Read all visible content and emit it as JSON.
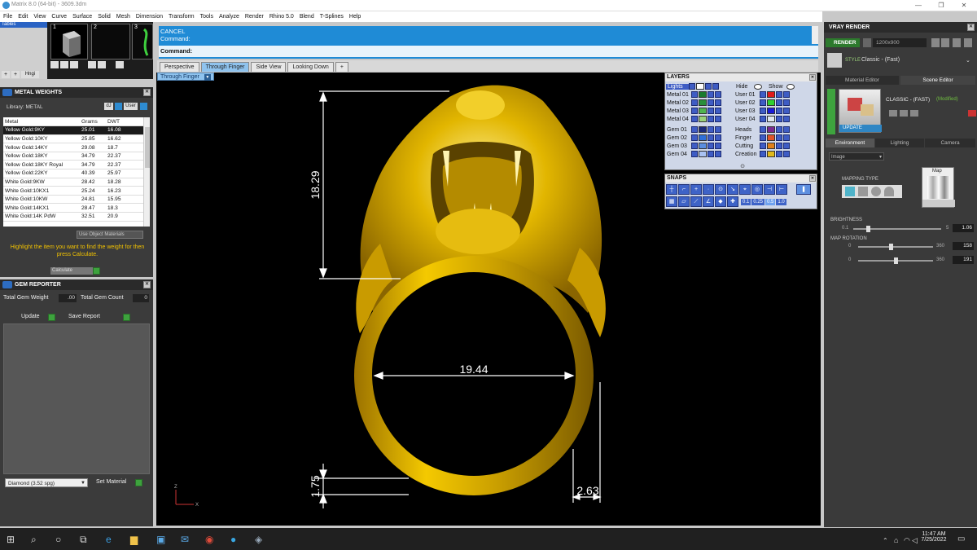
{
  "window": {
    "title": "Matrix 8.0 (64-bit) - 3609.3dm"
  },
  "menu": [
    "File",
    "Edit",
    "View",
    "Curve",
    "Surface",
    "Solid",
    "Mesh",
    "Dimension",
    "Transform",
    "Tools",
    "Analyze",
    "Render",
    "Rhino 5.0",
    "Blend",
    "T-Splines",
    "Help"
  ],
  "top_left": {
    "thumb_labels": [
      "1",
      "2",
      "3"
    ],
    "hinge_label": "Hngi",
    "tab_label": "Tables"
  },
  "metal_weights": {
    "title": "METAL WEIGHTS",
    "library_label": "Library: METAL",
    "btn_dj": "dJ",
    "btn_user": "User",
    "columns": [
      "Metal",
      "Grams",
      "DWT"
    ],
    "rows": [
      [
        "Yellow Gold:9KY",
        "25.01",
        "16.08"
      ],
      [
        "Yellow Gold:10KY",
        "25.85",
        "16.62"
      ],
      [
        "Yellow Gold:14KY",
        "29.08",
        "18.7"
      ],
      [
        "Yellow Gold:18KY",
        "34.79",
        "22.37"
      ],
      [
        "Yellow Gold:18KY Royal",
        "34.79",
        "22.37"
      ],
      [
        "Yellow Gold:22KY",
        "40.39",
        "25.97"
      ],
      [
        "White Gold:9KW",
        "28.42",
        "18.28"
      ],
      [
        "White Gold:10KX1",
        "25.24",
        "16.23"
      ],
      [
        "White Gold:10KW",
        "24.81",
        "15.95"
      ],
      [
        "White Gold:14KX1",
        "28.47",
        "18.3"
      ],
      [
        "White Gold:14K PdW",
        "32.51",
        "20.9"
      ]
    ],
    "use_object_materials": "Use Object Materials",
    "hint": "Highlight the item you want to find the weight for then press Calculate.",
    "calculate": "Calculate"
  },
  "gem_reporter": {
    "title": "GEM REPORTER",
    "total_gem_weight_label": "Total Gem Weight",
    "total_gem_weight_value": ".00",
    "total_gem_count_label": "Total Gem Count",
    "total_gem_count_value": "0",
    "update": "Update",
    "save_report": "Save Report",
    "material_select": "Diamond    (3.52 spg)",
    "set_material": "Set Material"
  },
  "command": {
    "line1": "CANCEL",
    "line2": "Command:",
    "prompt": "Command:"
  },
  "viewport_tabs": [
    "Perspective",
    "Through Finger",
    "Side View",
    "Looking Down",
    "+"
  ],
  "active_viewport_tab": "Through Finger",
  "viewport_label": "Through Finger",
  "dimensions": {
    "height": "18.29",
    "inner_diameter": "19.44",
    "band_thickness": "1.75",
    "band_width": "2.63"
  },
  "axis": {
    "z": "Z",
    "x": "X"
  },
  "layers": {
    "title": "LAYERS",
    "lights": "Lights",
    "hide": "Hide",
    "show": "Show",
    "left": [
      {
        "name": "Metal 01",
        "color": "#1a7a2e"
      },
      {
        "name": "Metal 02",
        "color": "#2a8f3a"
      },
      {
        "name": "Metal 03",
        "color": "#4fb34f"
      },
      {
        "name": "Metal 04",
        "color": "#9ad27a"
      },
      {
        "name": "Gem 01",
        "color": "#1b2a7a"
      },
      {
        "name": "Gem 02",
        "color": "#2e6fd8"
      },
      {
        "name": "Gem 03",
        "color": "#5b8ee0"
      },
      {
        "name": "Gem 04",
        "color": "#a9c2f2"
      }
    ],
    "right": [
      {
        "name": "User 01",
        "color": "#e01a1a"
      },
      {
        "name": "User 02",
        "color": "#2fd02f"
      },
      {
        "name": "User 03",
        "color": "#1a1ad8"
      },
      {
        "name": "User 04",
        "color": "#dfe7ef"
      },
      {
        "name": "Heads",
        "color": "#7a2a8f"
      },
      {
        "name": "Finger",
        "color": "#e0542a"
      },
      {
        "name": "Cutting",
        "color": "#e0801a"
      },
      {
        "name": "Creation",
        "color": "#e0b81a"
      }
    ]
  },
  "snaps": {
    "title": "SNAPS",
    "values": [
      "0.1",
      "0.25",
      "0.5",
      "1.0"
    ]
  },
  "vray": {
    "title": "VRAY RENDER",
    "render": "RENDER",
    "resolution": "1200x900",
    "style_label": "STYLE",
    "style_value": "Classic - (Fast)",
    "tabs": [
      "Material Editor",
      "Scene Editor"
    ],
    "scene_name": "CLASSIC - (FAST)",
    "modified": "(Modified)",
    "update": "UPDATE",
    "sub_tabs": [
      "Environment",
      "Lighting",
      "Camera"
    ],
    "env_select": "Image",
    "mapping_type": "MAPPING TYPE",
    "map_label": "Map",
    "brightness_label": "BRIGHTNESS",
    "brightness_min": "0.1",
    "brightness_max": "5",
    "brightness_value": "1.06",
    "map_rotation_label": "MAP ROTATION",
    "rot1_min": "0",
    "rot1_max": "360",
    "rot1_value": "158",
    "rot2_min": "0",
    "rot2_max": "360",
    "rot2_value": "191"
  },
  "taskbar": {
    "time": "11:47 AM",
    "date": "7/25/2022"
  }
}
